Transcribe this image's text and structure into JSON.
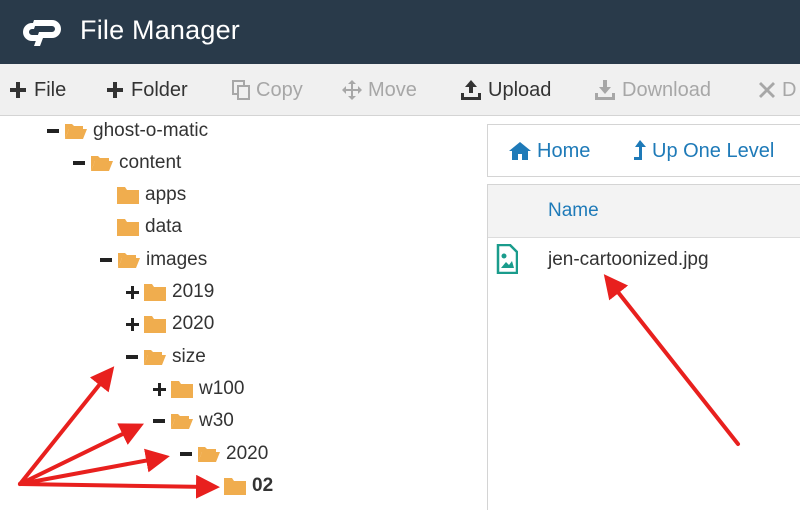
{
  "header": {
    "title": "File Manager",
    "logo_icon": "cpanel-logo-icon"
  },
  "toolbar": {
    "items": [
      {
        "label": "File",
        "icon": "plus-icon",
        "enabled": true
      },
      {
        "label": "Folder",
        "icon": "plus-icon",
        "enabled": true
      },
      {
        "label": "Copy",
        "icon": "copy-icon",
        "enabled": false
      },
      {
        "label": "Move",
        "icon": "move-icon",
        "enabled": false
      },
      {
        "label": "Upload",
        "icon": "upload-icon",
        "enabled": true
      },
      {
        "label": "Download",
        "icon": "download-icon",
        "enabled": false
      },
      {
        "label": "D",
        "icon": "close-icon",
        "enabled": false
      }
    ]
  },
  "tree": {
    "nodes": [
      {
        "label": "ghost-o-matic",
        "state": "expanded",
        "depth": 1
      },
      {
        "label": "content",
        "state": "expanded",
        "depth": 2
      },
      {
        "label": "apps",
        "state": "leaf",
        "depth": 3
      },
      {
        "label": "data",
        "state": "leaf",
        "depth": 3
      },
      {
        "label": "images",
        "state": "expanded",
        "depth": 3
      },
      {
        "label": "2019",
        "state": "collapsed",
        "depth": 4
      },
      {
        "label": "2020",
        "state": "collapsed",
        "depth": 4
      },
      {
        "label": "size",
        "state": "expanded",
        "depth": 4
      },
      {
        "label": "w100",
        "state": "collapsed",
        "depth": 5
      },
      {
        "label": "w30",
        "state": "expanded",
        "depth": 5
      },
      {
        "label": "2020",
        "state": "expanded",
        "depth": 6
      },
      {
        "label": "02",
        "state": "selected",
        "depth": 7
      }
    ]
  },
  "nav": {
    "home_label": "Home",
    "up_label": "Up One Level"
  },
  "file_list": {
    "column_name": "Name",
    "files": [
      {
        "name": "jen-cartoonized.jpg",
        "icon": "image-file-icon"
      }
    ]
  },
  "colors": {
    "header_bg": "#293a4a",
    "toolbar_bg": "#f0f0f0",
    "folder": "#f0ad4e",
    "link": "#1e7ab8",
    "file_icon": "#1a9c8c",
    "annotation_arrow": "#e8201e"
  }
}
